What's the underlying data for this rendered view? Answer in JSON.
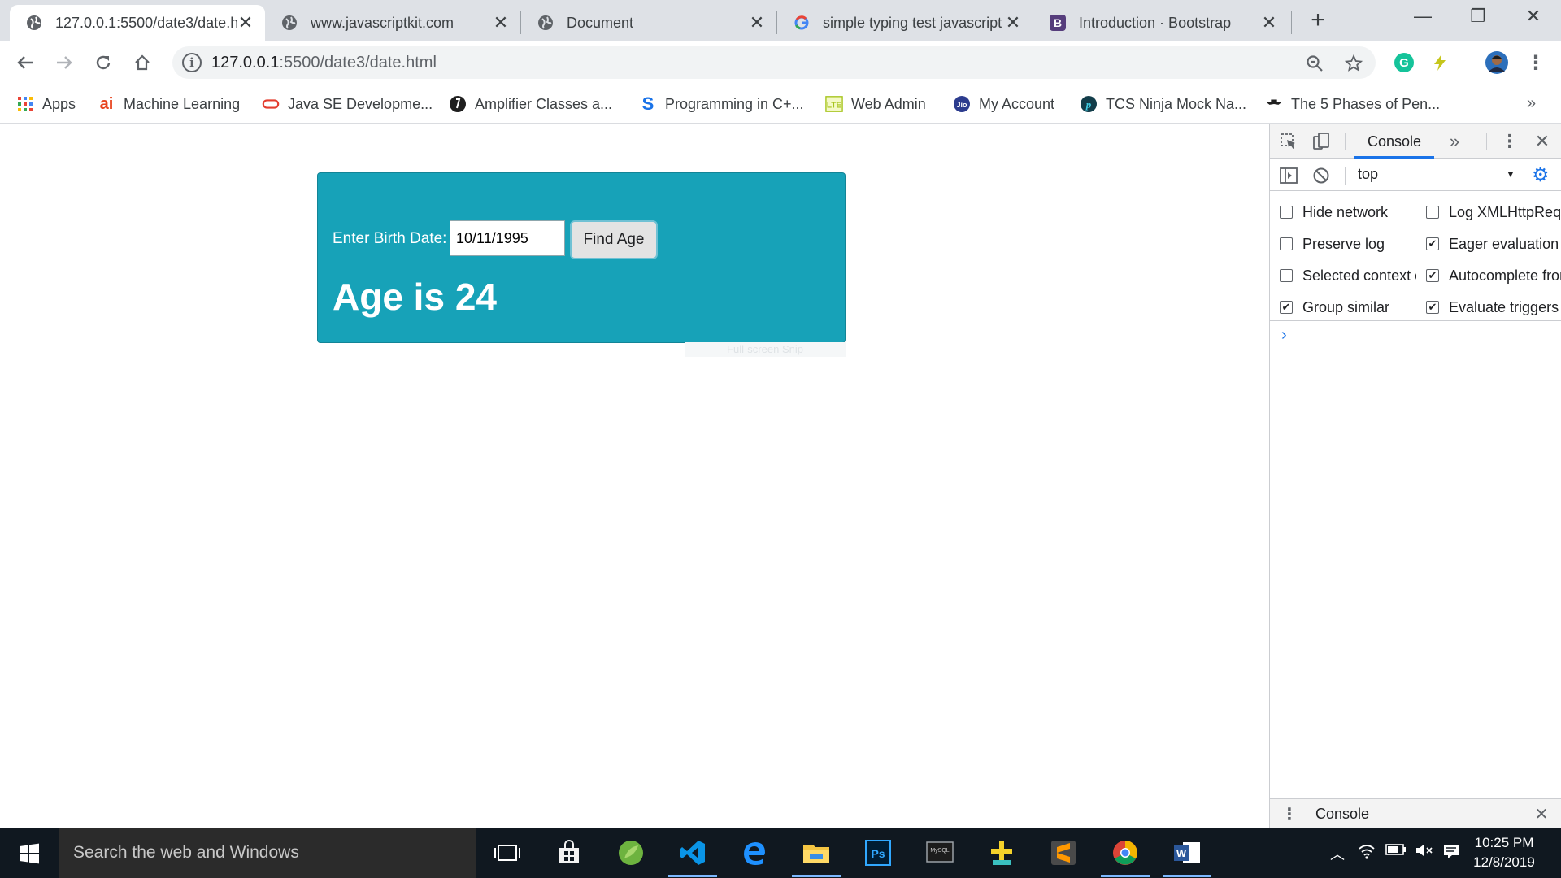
{
  "browser": {
    "tabs": [
      {
        "title": "127.0.0.1:5500/date3/date.h",
        "active": true,
        "favicon": "globe-icon"
      },
      {
        "title": "www.javascriptkit.com",
        "active": false,
        "favicon": "globe-icon"
      },
      {
        "title": "Document",
        "active": false,
        "favicon": "globe-icon"
      },
      {
        "title": "simple typing test javascript",
        "active": false,
        "favicon": "google-icon"
      },
      {
        "title": "Introduction · Bootstrap",
        "active": false,
        "favicon": "bootstrap-icon"
      }
    ],
    "new_tab_symbol": "+",
    "url_host": "127.0.0.1",
    "url_rest": ":5500/date3/date.html",
    "bookmarks": [
      {
        "label": "Apps",
        "icon": "apps-grid-icon"
      },
      {
        "label": "Machine Learning",
        "icon": "ai-icon"
      },
      {
        "label": "Java SE Developme...",
        "icon": "oracle-icon"
      },
      {
        "label": "Amplifier Classes a...",
        "icon": "amplifier-icon"
      },
      {
        "label": "Programming in C+...",
        "icon": "s-icon"
      },
      {
        "label": "Web Admin",
        "icon": "lte-icon"
      },
      {
        "label": "My Account",
        "icon": "jio-icon"
      },
      {
        "label": "TCS Ninja Mock Na...",
        "icon": "p-icon"
      },
      {
        "label": "The 5 Phases of Pen...",
        "icon": "hat-icon"
      }
    ],
    "bookmarks_more": "»"
  },
  "page": {
    "label": "Enter Birth Date:",
    "birth_date_value": "10/11/1995",
    "button_label": "Find Age",
    "result_text": "Age is 24",
    "faded_hint": "Full-screen Snip"
  },
  "devtools": {
    "tab_label": "Console",
    "more_tabs": "»",
    "context": "top",
    "options_left": [
      {
        "label": "Hide network",
        "checked": false
      },
      {
        "label": "Preserve log",
        "checked": false
      },
      {
        "label": "Selected context only",
        "checked": false
      },
      {
        "label": "Group similar",
        "checked": true
      }
    ],
    "options_right": [
      {
        "label": "Log XMLHttpRequests",
        "checked": false
      },
      {
        "label": "Eager evaluation",
        "checked": true
      },
      {
        "label": "Autocomplete from history",
        "checked": true
      },
      {
        "label": "Evaluate triggers user activation",
        "checked": true
      }
    ],
    "prompt": "›",
    "drawer_title": "Console"
  },
  "taskbar": {
    "search_placeholder": "Search the web and Windows",
    "time": "10:25 PM",
    "date": "12/8/2019"
  },
  "colors": {
    "card_bg": "#17a2b8",
    "accent": "#1a73e8",
    "taskbar_bg": "#101820"
  }
}
